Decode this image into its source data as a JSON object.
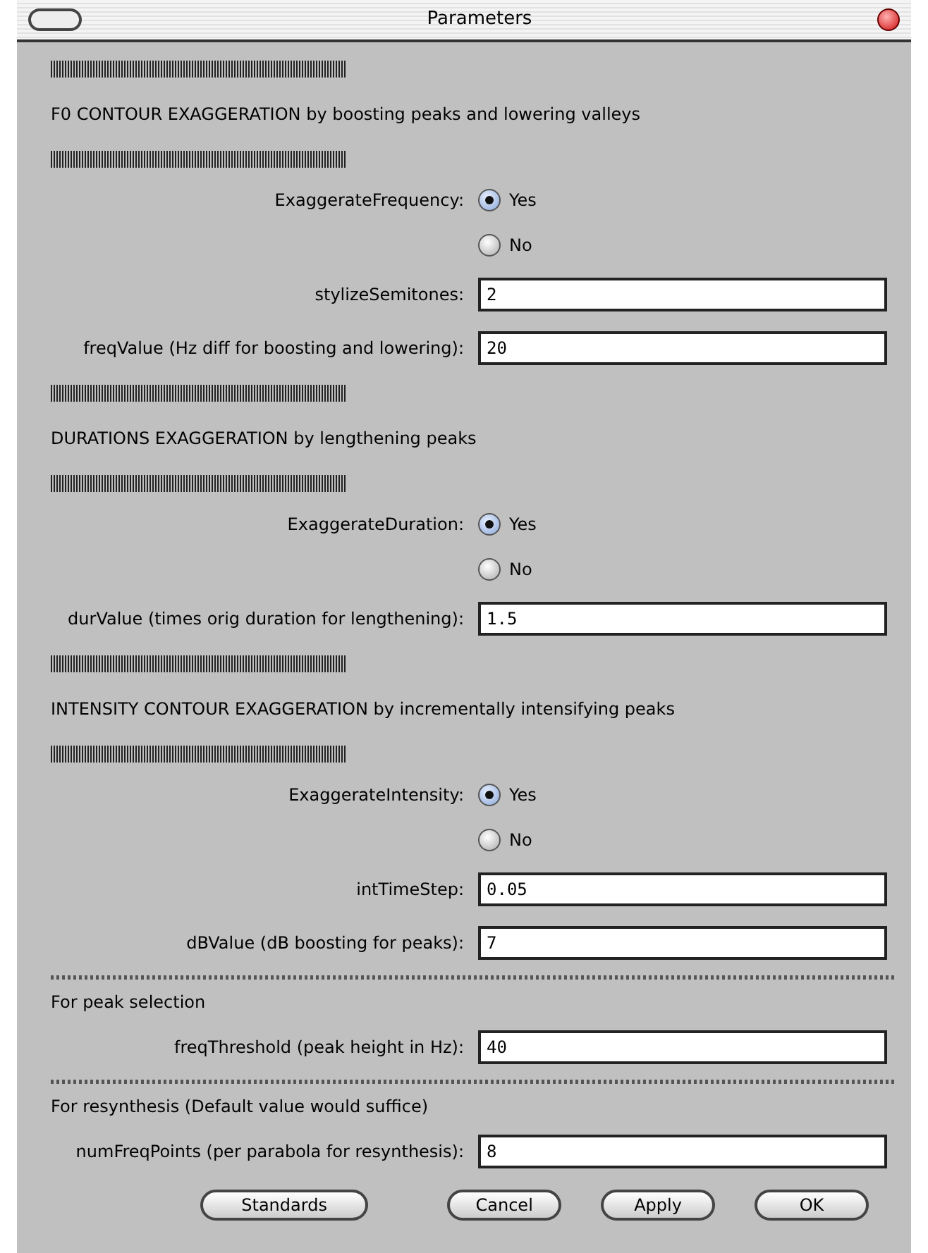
{
  "window": {
    "title": "Parameters"
  },
  "items": [
    {
      "kind": "bar"
    },
    {
      "kind": "heading",
      "text": "F0 CONTOUR EXAGGERATION by boosting peaks and lowering valleys"
    },
    {
      "kind": "bar"
    },
    {
      "kind": "radio",
      "label": "ExaggerateFrequency:",
      "options": [
        {
          "label": "Yes",
          "selected": true
        },
        {
          "label": "No",
          "selected": false
        }
      ]
    },
    {
      "kind": "field",
      "label": "stylizeSemitones:",
      "value": "2"
    },
    {
      "kind": "field",
      "label": "freqValue (Hz diff for boosting and lowering):",
      "value": "20"
    },
    {
      "kind": "bar"
    },
    {
      "kind": "heading",
      "text": "DURATIONS EXAGGERATION by lengthening peaks"
    },
    {
      "kind": "bar"
    },
    {
      "kind": "radio",
      "label": "ExaggerateDuration:",
      "options": [
        {
          "label": "Yes",
          "selected": true
        },
        {
          "label": "No",
          "selected": false
        }
      ]
    },
    {
      "kind": "field",
      "label": "durValue (times orig duration for lengthening):",
      "value": "1.5"
    },
    {
      "kind": "bar"
    },
    {
      "kind": "heading",
      "text": "INTENSITY CONTOUR EXAGGERATION by incrementally intensifying peaks"
    },
    {
      "kind": "bar"
    },
    {
      "kind": "radio",
      "label": "ExaggerateIntensity:",
      "options": [
        {
          "label": "Yes",
          "selected": true
        },
        {
          "label": "No",
          "selected": false
        }
      ]
    },
    {
      "kind": "field",
      "label": "intTimeStep:",
      "value": "0.05"
    },
    {
      "kind": "field",
      "label": "dBValue (dB boosting for peaks):",
      "value": "7"
    },
    {
      "kind": "wave"
    },
    {
      "kind": "note",
      "text": "For peak selection"
    },
    {
      "kind": "field",
      "label": "freqThreshold (peak height in Hz):",
      "value": "40"
    },
    {
      "kind": "wave"
    },
    {
      "kind": "note",
      "text": "For resynthesis (Default value would suffice)"
    },
    {
      "kind": "field",
      "label": "numFreqPoints (per parabola for resynthesis):",
      "value": "8"
    }
  ],
  "buttons": [
    "Standards",
    "Cancel",
    "Apply",
    "OK"
  ]
}
